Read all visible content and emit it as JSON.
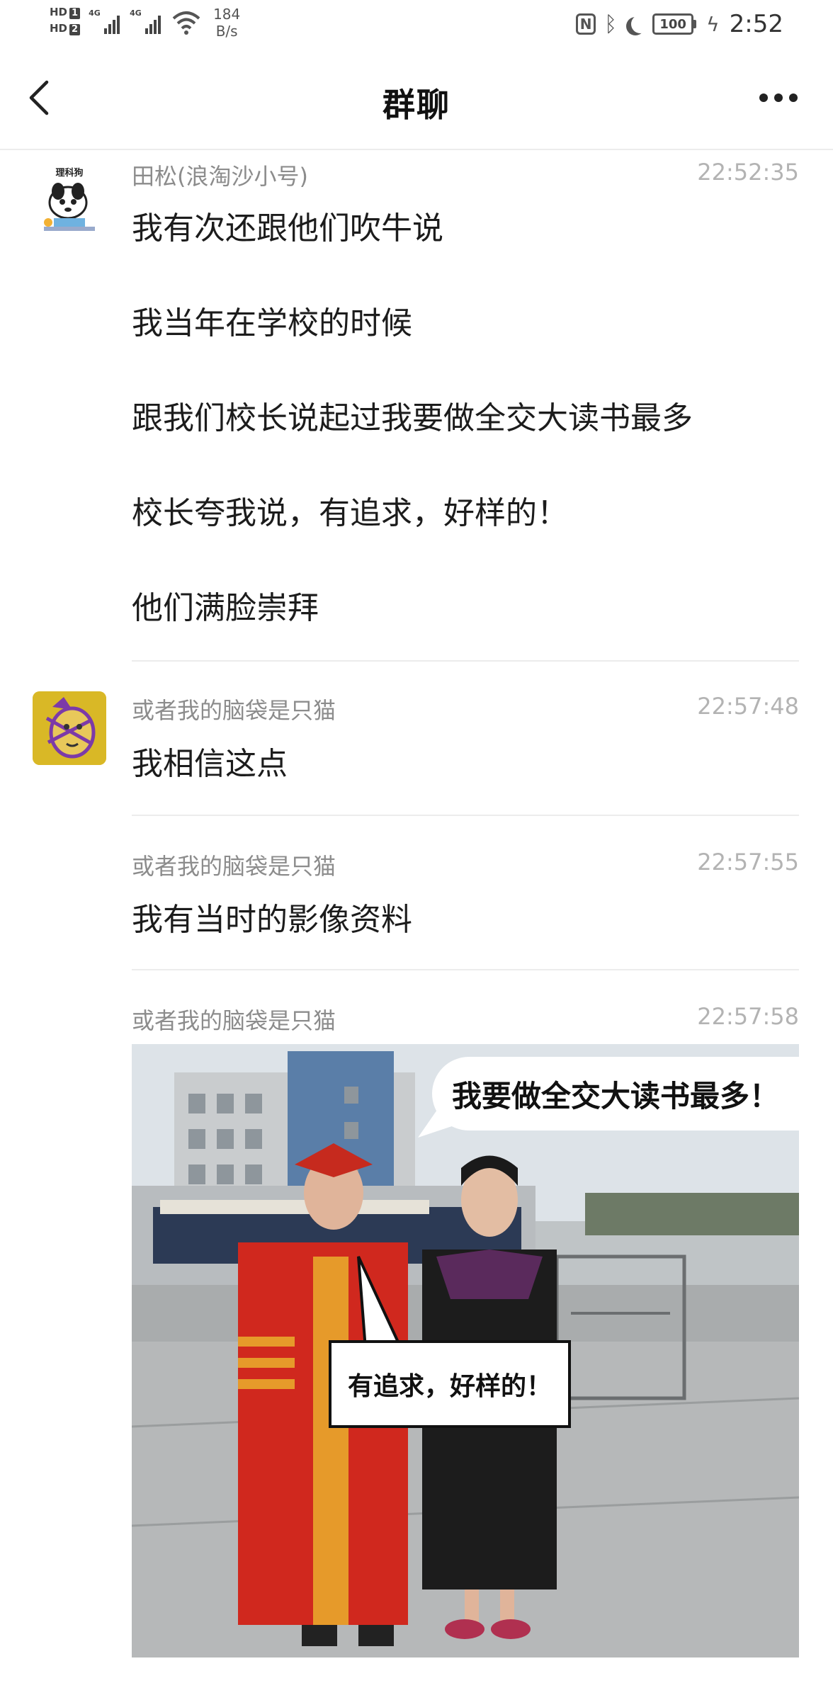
{
  "status_bar": {
    "sim1": "HD",
    "sim1_num": "1",
    "sim2": "HD",
    "sim2_num": "2",
    "net1": "4G",
    "net2": "4G",
    "speed_value": "184",
    "speed_unit": "B/s",
    "nfc": "N",
    "battery": "100",
    "time": "2:52"
  },
  "nav": {
    "title": "群聊"
  },
  "messages": [
    {
      "sender": "田松(浪淘沙小号)",
      "time": "22:52:35",
      "lines": [
        "我有次还跟他们吹牛说",
        "我当年在学校的时候",
        "跟我们校长说起过我要做全交大读书最多",
        "校长夸我说，有追求，好样的！",
        "他们满脸崇拜"
      ],
      "avatar_text": "理科狗"
    },
    {
      "sender": "或者我的脑袋是只猫",
      "time": "22:57:48",
      "lines": [
        "我相信这点"
      ]
    },
    {
      "sender": "或者我的脑袋是只猫",
      "time": "22:57:55",
      "lines": [
        "我有当时的影像资料"
      ]
    },
    {
      "sender": "或者我的脑袋是只猫",
      "time": "22:57:58",
      "image": {
        "caption_top": "我要做全交大读书最多！",
        "caption_middle": "有追求，好样的！"
      }
    }
  ],
  "colors": {
    "accent_red": "#d0281e",
    "gown_orange": "#e69a2a",
    "sky": "#dde3e8"
  }
}
